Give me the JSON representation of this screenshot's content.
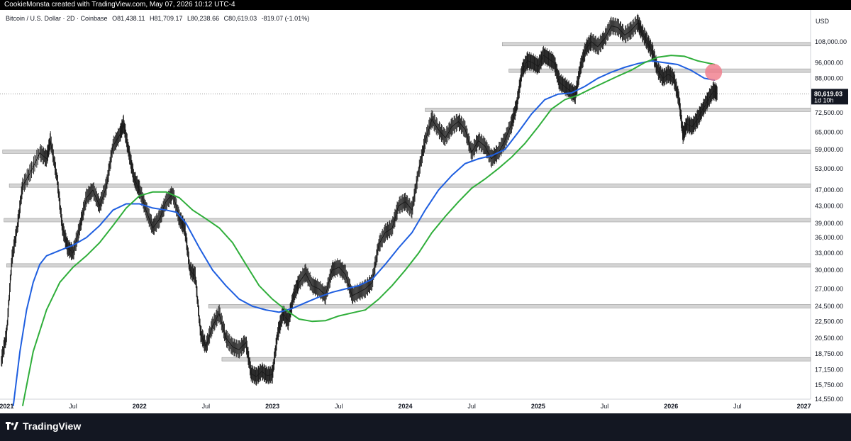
{
  "topbar": {
    "credit": "CookieMonsta created with TradingView.com, May 07, 2026 10:12 UTC-4"
  },
  "header": {
    "symbol": "Bitcoin / U.S. Dollar · 2D · Coinbase",
    "open": "O81,438.11",
    "high": "H81,709.17",
    "low": "L80,238.66",
    "close": "C80,619.03",
    "change": "-819.07 (-1.01%)"
  },
  "footer": {
    "brand": "TradingView"
  },
  "colors": {
    "ma_fast": "#1f5fe0",
    "ma_slow": "#2fae3a",
    "zone_fill": "#d4d4d4",
    "circle": "#f07a8a"
  },
  "chart_data": {
    "type": "line",
    "title": "Bitcoin / U.S. Dollar · 2D · Coinbase",
    "currency_label": "USD",
    "y_scale": "log",
    "ylim": [
      14550,
      125000
    ],
    "yticks": [
      "108,000.00",
      "96,000.00",
      "88,000.00",
      "72,500.00",
      "65,000.00",
      "59,000.00",
      "53,000.00",
      "47,000.00",
      "43,000.00",
      "39,000.00",
      "36,000.00",
      "33,000.00",
      "30,000.00",
      "27,000.00",
      "24,500.00",
      "22,500.00",
      "20,500.00",
      "18,750.00",
      "17,150.00",
      "15,750.00",
      "14,550.00"
    ],
    "xticks": [
      {
        "label": "2021",
        "year": true,
        "t": 2021.0
      },
      {
        "label": "Jul",
        "year": false,
        "t": 2021.5
      },
      {
        "label": "2022",
        "year": true,
        "t": 2022.0
      },
      {
        "label": "Jul",
        "year": false,
        "t": 2022.5
      },
      {
        "label": "2023",
        "year": true,
        "t": 2023.0
      },
      {
        "label": "Jul",
        "year": false,
        "t": 2023.5
      },
      {
        "label": "2024",
        "year": true,
        "t": 2024.0
      },
      {
        "label": "Jul",
        "year": false,
        "t": 2024.5
      },
      {
        "label": "2025",
        "year": true,
        "t": 2025.0
      },
      {
        "label": "Jul",
        "year": false,
        "t": 2025.5
      },
      {
        "label": "2026",
        "year": true,
        "t": 2026.0
      },
      {
        "label": "Jul",
        "year": false,
        "t": 2026.5
      },
      {
        "label": "2027",
        "year": true,
        "t": 2027.0
      }
    ],
    "xlim": [
      2020.95,
      2027.05
    ],
    "last_price": {
      "label": "80,619.03",
      "countdown": "1d 10h",
      "value": 80619.03
    },
    "price_path": [
      [
        2020.96,
        18000
      ],
      [
        2021.0,
        21000
      ],
      [
        2021.04,
        32000
      ],
      [
        2021.08,
        38000
      ],
      [
        2021.12,
        48000
      ],
      [
        2021.18,
        52000
      ],
      [
        2021.25,
        58000
      ],
      [
        2021.3,
        56000
      ],
      [
        2021.33,
        62000
      ],
      [
        2021.38,
        50000
      ],
      [
        2021.42,
        38000
      ],
      [
        2021.46,
        34000
      ],
      [
        2021.5,
        33000
      ],
      [
        2021.55,
        38000
      ],
      [
        2021.6,
        45000
      ],
      [
        2021.65,
        47000
      ],
      [
        2021.7,
        43000
      ],
      [
        2021.75,
        48000
      ],
      [
        2021.8,
        60000
      ],
      [
        2021.85,
        64000
      ],
      [
        2021.88,
        68000
      ],
      [
        2021.92,
        58000
      ],
      [
        2021.96,
        50000
      ],
      [
        2022.0,
        47000
      ],
      [
        2022.05,
        42000
      ],
      [
        2022.1,
        38000
      ],
      [
        2022.15,
        40000
      ],
      [
        2022.2,
        44000
      ],
      [
        2022.25,
        46000
      ],
      [
        2022.3,
        40000
      ],
      [
        2022.34,
        38000
      ],
      [
        2022.38,
        30000
      ],
      [
        2022.42,
        29000
      ],
      [
        2022.46,
        21000
      ],
      [
        2022.5,
        19500
      ],
      [
        2022.55,
        22000
      ],
      [
        2022.6,
        23500
      ],
      [
        2022.65,
        20500
      ],
      [
        2022.7,
        19500
      ],
      [
        2022.75,
        19200
      ],
      [
        2022.8,
        20000
      ],
      [
        2022.84,
        16800
      ],
      [
        2022.88,
        16500
      ],
      [
        2022.92,
        17000
      ],
      [
        2022.96,
        16600
      ],
      [
        2023.0,
        16700
      ],
      [
        2023.04,
        21000
      ],
      [
        2023.08,
        23500
      ],
      [
        2023.12,
        22500
      ],
      [
        2023.16,
        26000
      ],
      [
        2023.2,
        28000
      ],
      [
        2023.25,
        29500
      ],
      [
        2023.3,
        27500
      ],
      [
        2023.35,
        27000
      ],
      [
        2023.4,
        26000
      ],
      [
        2023.45,
        30000
      ],
      [
        2023.5,
        30500
      ],
      [
        2023.55,
        29300
      ],
      [
        2023.6,
        26000
      ],
      [
        2023.65,
        26500
      ],
      [
        2023.7,
        27000
      ],
      [
        2023.75,
        28000
      ],
      [
        2023.8,
        34500
      ],
      [
        2023.85,
        37000
      ],
      [
        2023.9,
        38000
      ],
      [
        2023.95,
        43000
      ],
      [
        2024.0,
        44000
      ],
      [
        2024.05,
        42000
      ],
      [
        2024.1,
        52000
      ],
      [
        2024.15,
        62000
      ],
      [
        2024.2,
        70000
      ],
      [
        2024.25,
        66000
      ],
      [
        2024.3,
        63000
      ],
      [
        2024.35,
        67000
      ],
      [
        2024.4,
        69000
      ],
      [
        2024.45,
        66000
      ],
      [
        2024.5,
        58000
      ],
      [
        2024.55,
        62000
      ],
      [
        2024.6,
        60000
      ],
      [
        2024.65,
        56000
      ],
      [
        2024.7,
        58000
      ],
      [
        2024.75,
        62000
      ],
      [
        2024.8,
        68000
      ],
      [
        2024.84,
        76000
      ],
      [
        2024.88,
        92000
      ],
      [
        2024.92,
        97000
      ],
      [
        2024.96,
        96000
      ],
      [
        2025.0,
        94000
      ],
      [
        2025.04,
        100000
      ],
      [
        2025.08,
        98000
      ],
      [
        2025.12,
        96000
      ],
      [
        2025.16,
        86000
      ],
      [
        2025.2,
        84000
      ],
      [
        2025.24,
        82000
      ],
      [
        2025.28,
        80000
      ],
      [
        2025.32,
        94000
      ],
      [
        2025.36,
        104000
      ],
      [
        2025.4,
        108000
      ],
      [
        2025.45,
        105000
      ],
      [
        2025.5,
        110000
      ],
      [
        2025.55,
        118000
      ],
      [
        2025.6,
        117000
      ],
      [
        2025.65,
        112000
      ],
      [
        2025.7,
        115000
      ],
      [
        2025.75,
        120000
      ],
      [
        2025.78,
        114000
      ],
      [
        2025.82,
        108000
      ],
      [
        2025.86,
        102000
      ],
      [
        2025.9,
        92000
      ],
      [
        2025.94,
        88000
      ],
      [
        2025.98,
        90000
      ],
      [
        2026.02,
        88000
      ],
      [
        2026.06,
        78000
      ],
      [
        2026.09,
        64000
      ],
      [
        2026.12,
        68000
      ],
      [
        2026.16,
        67000
      ],
      [
        2026.2,
        70000
      ],
      [
        2026.24,
        74000
      ],
      [
        2026.28,
        78000
      ],
      [
        2026.32,
        82000
      ],
      [
        2026.35,
        80619
      ]
    ],
    "series": [
      {
        "name": "",
        "color_key": "ma_fast",
        "values": [
          [
            2021.05,
            14000
          ],
          [
            2021.1,
            19000
          ],
          [
            2021.15,
            24000
          ],
          [
            2021.2,
            28000
          ],
          [
            2021.25,
            31000
          ],
          [
            2021.3,
            32500
          ],
          [
            2021.4,
            33500
          ],
          [
            2021.5,
            34500
          ],
          [
            2021.6,
            36000
          ],
          [
            2021.7,
            38500
          ],
          [
            2021.8,
            42000
          ],
          [
            2021.9,
            43500
          ],
          [
            2022.0,
            43500
          ],
          [
            2022.1,
            42500
          ],
          [
            2022.2,
            42000
          ],
          [
            2022.28,
            41500
          ],
          [
            2022.35,
            39000
          ],
          [
            2022.45,
            34000
          ],
          [
            2022.55,
            30000
          ],
          [
            2022.65,
            27500
          ],
          [
            2022.75,
            25500
          ],
          [
            2022.85,
            24500
          ],
          [
            2022.95,
            24000
          ],
          [
            2023.05,
            23700
          ],
          [
            2023.15,
            24200
          ],
          [
            2023.25,
            25000
          ],
          [
            2023.35,
            25800
          ],
          [
            2023.45,
            26500
          ],
          [
            2023.55,
            27000
          ],
          [
            2023.65,
            27500
          ],
          [
            2023.75,
            28500
          ],
          [
            2023.85,
            31000
          ],
          [
            2023.95,
            34000
          ],
          [
            2024.05,
            37000
          ],
          [
            2024.15,
            42000
          ],
          [
            2024.25,
            47000
          ],
          [
            2024.35,
            51000
          ],
          [
            2024.45,
            54500
          ],
          [
            2024.55,
            56000
          ],
          [
            2024.65,
            57000
          ],
          [
            2024.75,
            59000
          ],
          [
            2024.85,
            65000
          ],
          [
            2024.95,
            72000
          ],
          [
            2025.05,
            78000
          ],
          [
            2025.15,
            80500
          ],
          [
            2025.25,
            81000
          ],
          [
            2025.35,
            84000
          ],
          [
            2025.45,
            88000
          ],
          [
            2025.55,
            91000
          ],
          [
            2025.65,
            93500
          ],
          [
            2025.75,
            95500
          ],
          [
            2025.85,
            97000
          ],
          [
            2025.95,
            96000
          ],
          [
            2026.05,
            95000
          ],
          [
            2026.15,
            92000
          ],
          [
            2026.25,
            88000
          ],
          [
            2026.33,
            87000
          ]
        ]
      },
      {
        "name": "",
        "color_key": "ma_slow",
        "values": [
          [
            2021.12,
            14000
          ],
          [
            2021.2,
            19000
          ],
          [
            2021.3,
            24000
          ],
          [
            2021.4,
            28000
          ],
          [
            2021.5,
            30500
          ],
          [
            2021.6,
            32500
          ],
          [
            2021.7,
            35000
          ],
          [
            2021.8,
            38500
          ],
          [
            2021.9,
            42500
          ],
          [
            2022.0,
            45500
          ],
          [
            2022.1,
            46500
          ],
          [
            2022.2,
            46500
          ],
          [
            2022.3,
            45000
          ],
          [
            2022.4,
            42000
          ],
          [
            2022.5,
            40000
          ],
          [
            2022.6,
            38000
          ],
          [
            2022.7,
            35000
          ],
          [
            2022.8,
            31000
          ],
          [
            2022.9,
            27500
          ],
          [
            2023.0,
            25500
          ],
          [
            2023.1,
            24000
          ],
          [
            2023.2,
            22800
          ],
          [
            2023.3,
            22500
          ],
          [
            2023.4,
            22600
          ],
          [
            2023.5,
            23200
          ],
          [
            2023.6,
            23600
          ],
          [
            2023.7,
            24000
          ],
          [
            2023.8,
            25500
          ],
          [
            2023.9,
            27500
          ],
          [
            2024.0,
            30000
          ],
          [
            2024.1,
            33000
          ],
          [
            2024.2,
            37000
          ],
          [
            2024.3,
            40500
          ],
          [
            2024.4,
            44000
          ],
          [
            2024.5,
            47500
          ],
          [
            2024.6,
            50000
          ],
          [
            2024.7,
            53000
          ],
          [
            2024.8,
            56500
          ],
          [
            2024.9,
            61000
          ],
          [
            2025.0,
            67000
          ],
          [
            2025.1,
            74000
          ],
          [
            2025.2,
            78000
          ],
          [
            2025.3,
            80000
          ],
          [
            2025.4,
            83000
          ],
          [
            2025.5,
            86000
          ],
          [
            2025.6,
            89000
          ],
          [
            2025.7,
            92000
          ],
          [
            2025.8,
            96000
          ],
          [
            2025.9,
            99000
          ],
          [
            2026.0,
            100000
          ],
          [
            2026.1,
            99500
          ],
          [
            2026.2,
            97000
          ],
          [
            2026.33,
            95000
          ]
        ]
      }
    ],
    "zones": [
      {
        "value": 106500,
        "x_start": 2024.73
      },
      {
        "value": 91800,
        "x_start": 2024.78
      },
      {
        "value": 73700,
        "x_start": 2024.15
      },
      {
        "value": 58300,
        "x_start": 2020.97
      },
      {
        "value": 48200,
        "x_start": 2021.02
      },
      {
        "value": 39700,
        "x_start": 2020.98
      },
      {
        "value": 30800,
        "x_start": 2021.0
      },
      {
        "value": 24500,
        "x_start": 2022.52
      },
      {
        "value": 18200,
        "x_start": 2022.62
      }
    ],
    "highlight_circle": {
      "t": 2026.32,
      "value": 91000
    }
  }
}
